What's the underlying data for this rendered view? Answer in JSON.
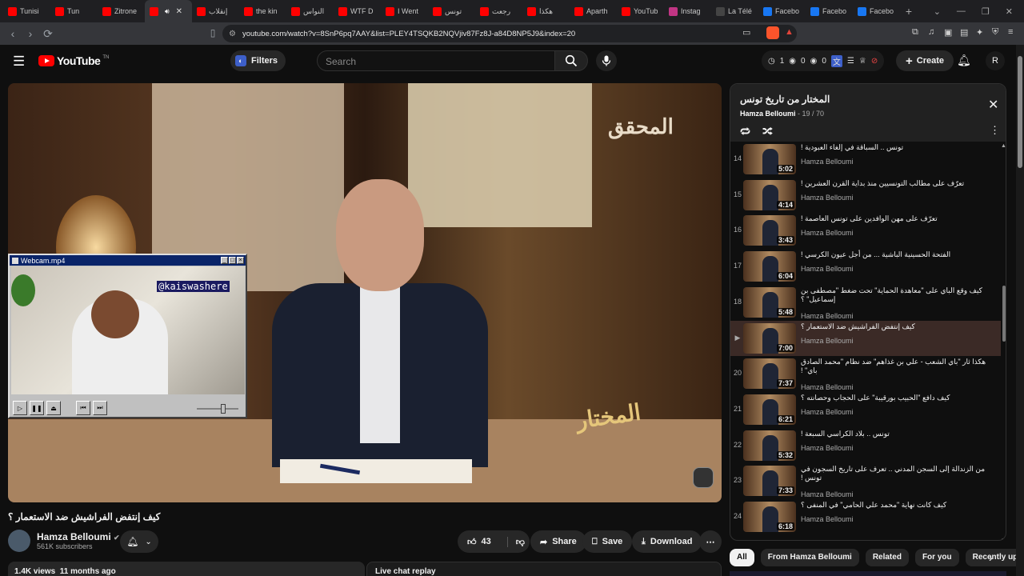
{
  "browser": {
    "tabs": [
      {
        "label": "Tunisi",
        "color": "#ff0000"
      },
      {
        "label": "Tun",
        "color": "#ff0000"
      },
      {
        "label": "Zitrone",
        "color": "#ff0000"
      },
      {
        "label": "",
        "color": "#ff0000",
        "active": true
      },
      {
        "label": "إنقلاب",
        "color": "#ff0000"
      },
      {
        "label": "the kin",
        "color": "#ff0000"
      },
      {
        "label": "النواس",
        "color": "#ff0000"
      },
      {
        "label": "WTF D",
        "color": "#ff0000"
      },
      {
        "label": "I Went",
        "color": "#ff0000"
      },
      {
        "label": "تونس",
        "color": "#ff0000"
      },
      {
        "label": "رجعت",
        "color": "#ff0000"
      },
      {
        "label": "هكذا",
        "color": "#ff0000"
      },
      {
        "label": "Aparth",
        "color": "#ff0000"
      },
      {
        "label": "YouTub",
        "color": "#ff0000"
      },
      {
        "label": "Instag",
        "color": "#c13584"
      },
      {
        "label": "La Télé",
        "color": "#444444"
      },
      {
        "label": "Facebo",
        "color": "#1877f2"
      },
      {
        "label": "Facebo",
        "color": "#1877f2"
      },
      {
        "label": "Facebo",
        "color": "#1877f2"
      }
    ],
    "new_tab": "+",
    "url": "youtube.com/watch?v=8SnP6pq7AAY&list=PLEY4TSQKB2NQVjiv87Fz8J-a84D8NP5J9&index=20"
  },
  "header": {
    "logo_text": "YouTube",
    "logo_sup": "TN",
    "filters_label": "Filters",
    "search_placeholder": "Search",
    "stats": [
      "1",
      "0",
      "0"
    ],
    "create_label": "Create",
    "avatar_letter": "R"
  },
  "video": {
    "brand_text": "المحقق",
    "brand2_text": "المختار",
    "title": "كيف إنتفض الفراشيش ضد الاستعمار ؟"
  },
  "webcam": {
    "title": "Webcam.mp4",
    "tag": "@kaiswashere"
  },
  "channel": {
    "name": "Hamza Belloumi",
    "subscribers": "561K subscribers"
  },
  "actions": {
    "likes": "43",
    "share": "Share",
    "save": "Save",
    "download": "Download"
  },
  "meta": {
    "views": "1.4K views",
    "age": "11 months ago",
    "live_chat": "Live chat replay"
  },
  "playlist": {
    "title": "المختار من تاريخ تونس",
    "owner": "Hamza Belloumi",
    "position": "19 / 70",
    "items": [
      {
        "num": "14",
        "title": "تونس .. السباقة في إلغاء العبودية !",
        "channel": "Hamza Belloumi",
        "duration": "5:02"
      },
      {
        "num": "15",
        "title": "تعرّف على مطالب التونسيين منذ بداية القرن العشرين !",
        "channel": "Hamza Belloumi",
        "duration": "4:14"
      },
      {
        "num": "16",
        "title": "تعرّف على مهن الوافدين على تونس العاصمة !",
        "channel": "Hamza Belloumi",
        "duration": "3:43"
      },
      {
        "num": "17",
        "title": "الفتحة الحسينية الباشية ... من أجل عيون الكرسي !",
        "channel": "Hamza Belloumi",
        "duration": "6:04"
      },
      {
        "num": "18",
        "title": "كيف وقع الباي على \"معاهدة الحماية\" تحت ضغط \"مصطفى بن إسماعيل\" ؟",
        "channel": "Hamza Belloumi",
        "duration": "5:48"
      },
      {
        "num": "",
        "title": "كيف إنتفض الفراشيش ضد الاستعمار ؟",
        "channel": "Hamza Belloumi",
        "duration": "7:00",
        "active": true
      },
      {
        "num": "20",
        "title": "هكذا ثار \"باي الشعب - علي بن غذاهم\" ضد نظام \"محمد الصادق باي\" !",
        "channel": "Hamza Belloumi",
        "duration": "7:37"
      },
      {
        "num": "21",
        "title": "كيف دافع \"الحبيب بورقيبة\" على الحجاب وحصانته ؟",
        "channel": "Hamza Belloumi",
        "duration": "6:21"
      },
      {
        "num": "22",
        "title": "تونس .. بلاد الكراسي السبعة !",
        "channel": "Hamza Belloumi",
        "duration": "5:32"
      },
      {
        "num": "23",
        "title": "من الزندالة إلى السجن المدني .. تعرف على تاريخ السجون في تونس !",
        "channel": "Hamza Belloumi",
        "duration": "7:33"
      },
      {
        "num": "24",
        "title": "كيف كانت نهاية \"محمد علي الحامي\" في المنفى ؟",
        "channel": "Hamza Belloumi",
        "duration": "6:18"
      }
    ]
  },
  "chips": [
    "All",
    "From Hamza Belloumi",
    "Related",
    "For you",
    "Recently up"
  ]
}
